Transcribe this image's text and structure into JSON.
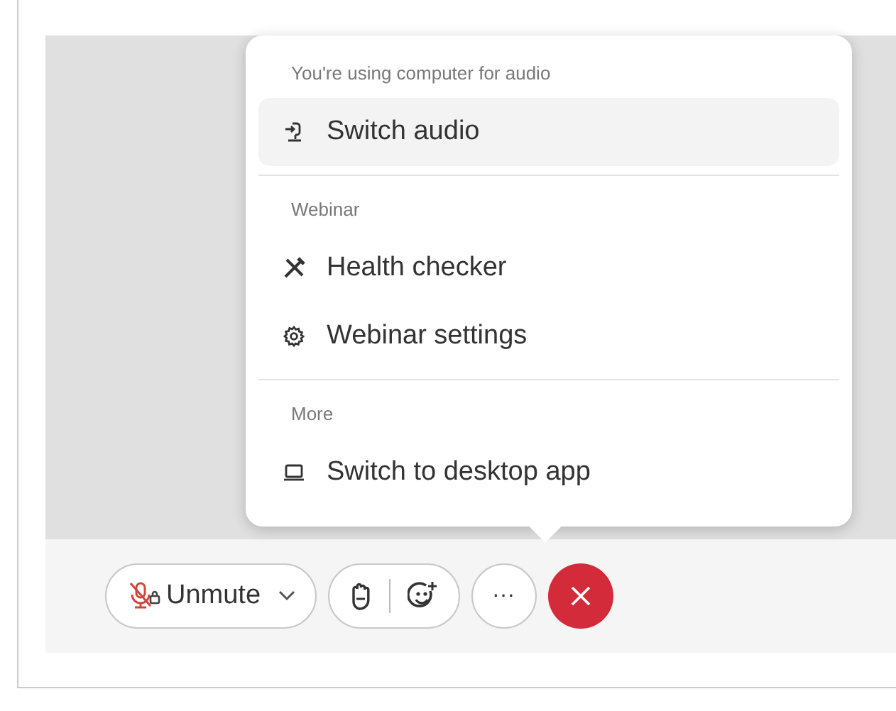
{
  "menu": {
    "sections": [
      {
        "header": "You're using computer for audio",
        "items": [
          {
            "label": "Switch audio",
            "kind": "audio",
            "highlighted": true
          }
        ]
      },
      {
        "header": "Webinar",
        "items": [
          {
            "label": "Health checker",
            "kind": "tools",
            "highlighted": false
          },
          {
            "label": "Webinar settings",
            "kind": "gear",
            "highlighted": false
          }
        ]
      },
      {
        "header": "More",
        "items": [
          {
            "label": "Switch to desktop app",
            "kind": "laptop",
            "highlighted": false
          }
        ]
      }
    ]
  },
  "controls": {
    "unmute": {
      "label": "Unmute",
      "muted": true
    },
    "more": {
      "label": "···"
    }
  }
}
